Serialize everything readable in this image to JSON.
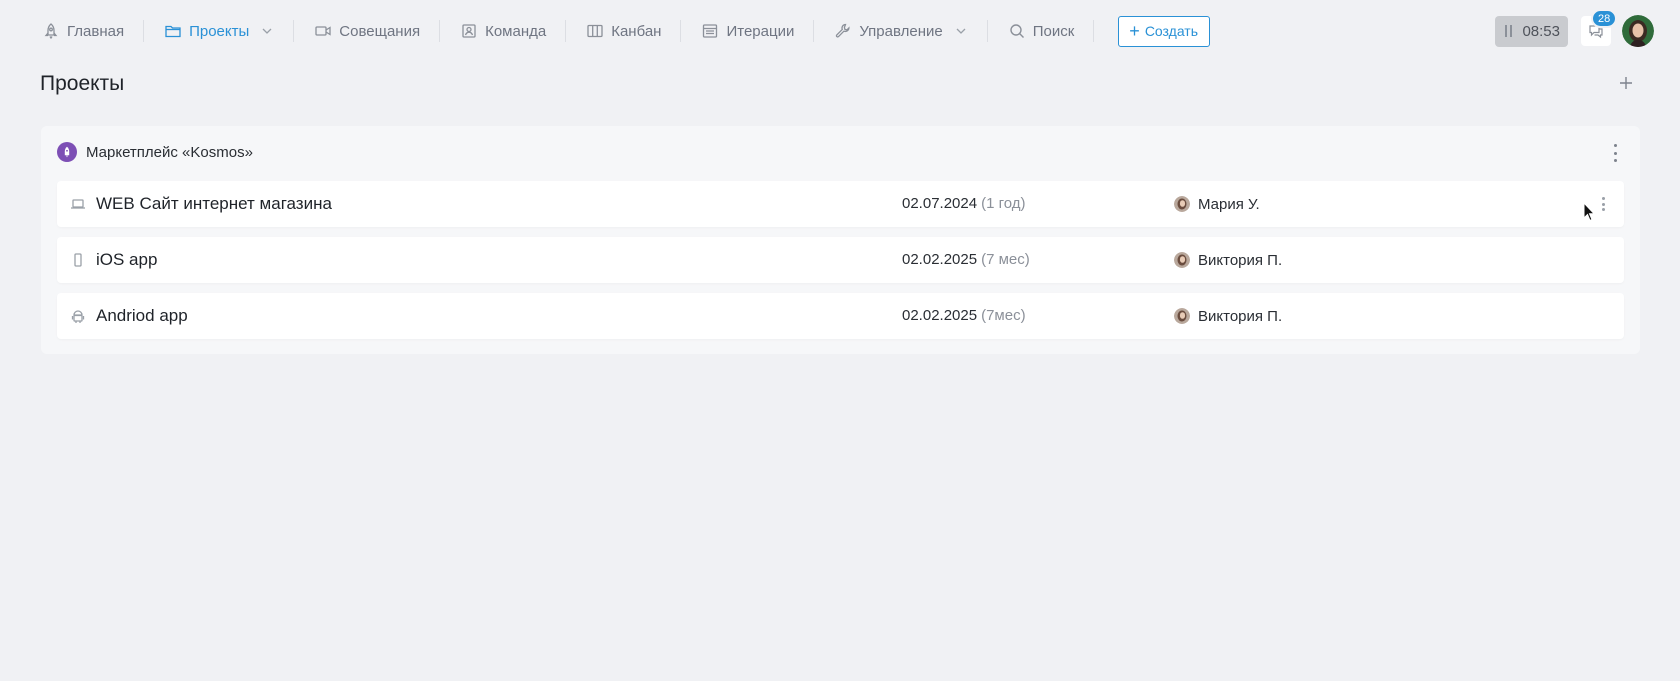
{
  "nav": {
    "items": [
      {
        "label": "Главная",
        "icon": "rocket-icon"
      },
      {
        "label": "Проекты",
        "icon": "folder-icon",
        "active": true,
        "dropdown": true
      },
      {
        "label": "Совещания",
        "icon": "video-icon"
      },
      {
        "label": "Команда",
        "icon": "team-icon"
      },
      {
        "label": "Канбан",
        "icon": "kanban-icon"
      },
      {
        "label": "Итерации",
        "icon": "calendar-icon"
      },
      {
        "label": "Управление",
        "icon": "wrench-icon",
        "dropdown": true
      },
      {
        "label": "Поиск",
        "icon": "search-icon"
      }
    ],
    "create_label": "Создать"
  },
  "tools": {
    "timer": "08:53",
    "notifications_count": "28"
  },
  "page": {
    "title": "Проекты"
  },
  "group": {
    "name": "Маркетплейс «Kosmos»",
    "projects": [
      {
        "name": "WEB Сайт интернет магазина",
        "icon": "laptop-icon",
        "date": "02.07.2024",
        "duration": "(1 год)",
        "owner": "Мария У."
      },
      {
        "name": "iOS app",
        "icon": "phone-icon",
        "date": "02.02.2025",
        "duration": "(7 мес)",
        "owner": "Виктория П."
      },
      {
        "name": "Andriod app",
        "icon": "android-icon",
        "date": "02.02.2025",
        "duration": "(7мес)",
        "owner": "Виктория П."
      }
    ]
  },
  "colors": {
    "accent": "#2a91d6",
    "background": "#f0f1f4",
    "group_icon": "#7d4fb5",
    "timer_bg": "#c9cbcf"
  }
}
